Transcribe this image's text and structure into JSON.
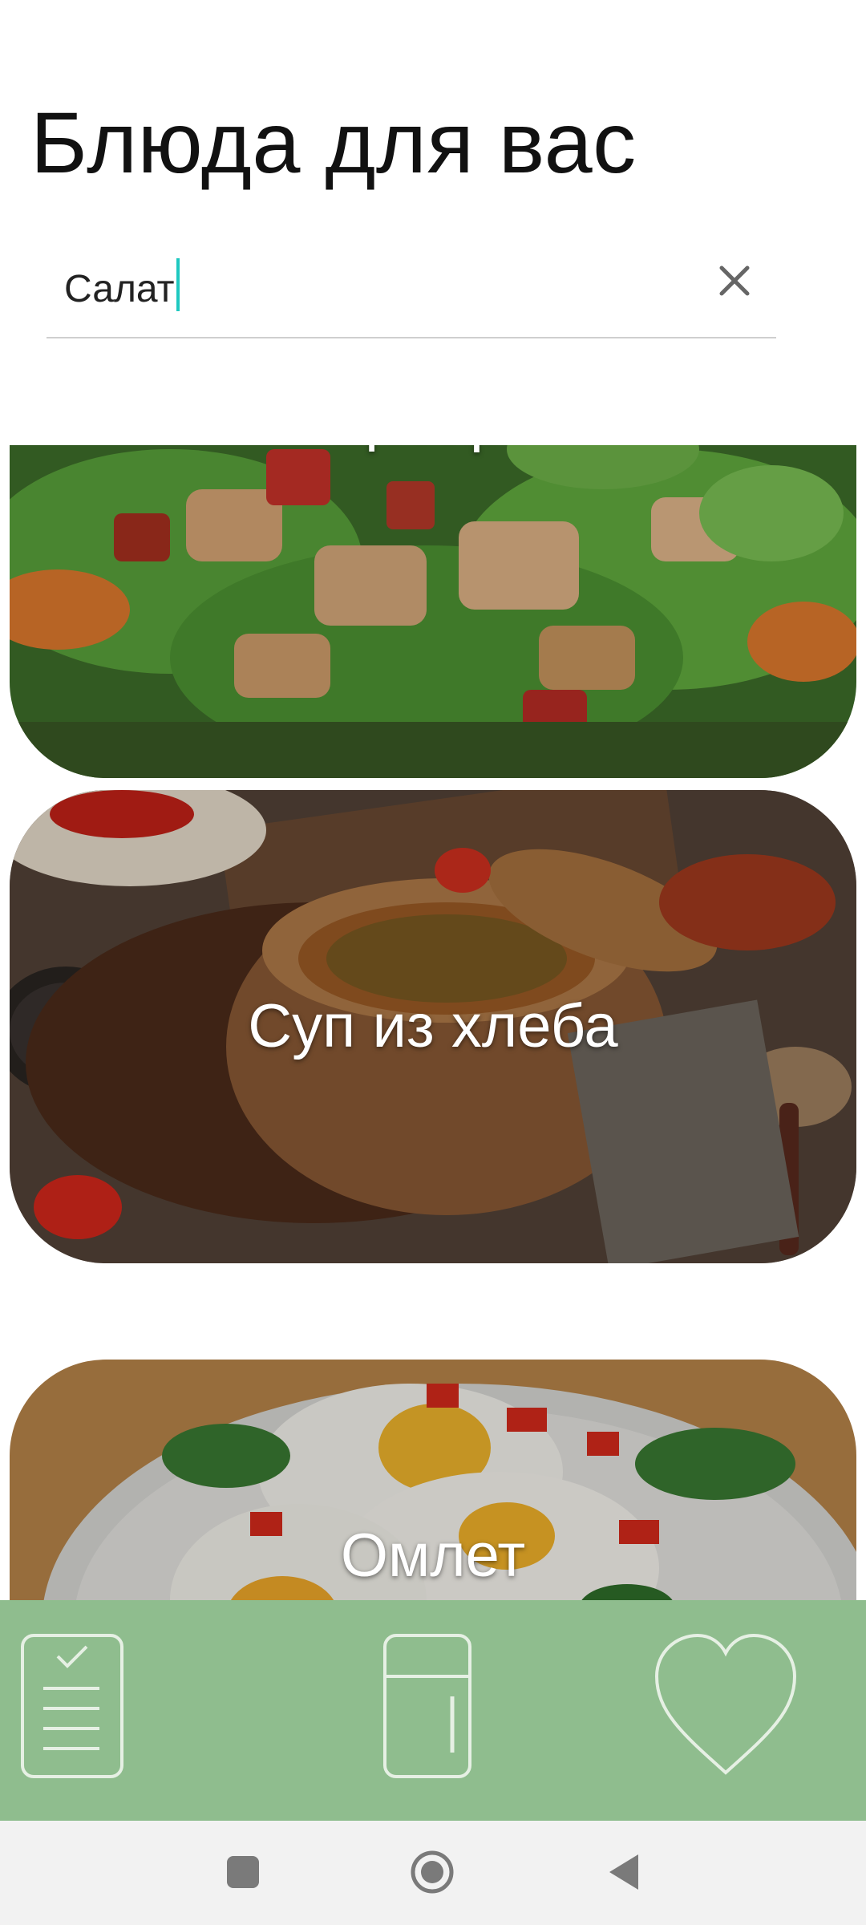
{
  "header": {
    "title": "Блюда для вас"
  },
  "search": {
    "value": "Салат",
    "clear_icon": "close-icon"
  },
  "dishes": [
    {
      "name": "Цезарь",
      "image": "caesar-salad-photo"
    },
    {
      "name": "Суп из хлеба",
      "image": "bread-bowl-soup-photo"
    },
    {
      "name": "Омлет",
      "image": "fried-eggs-photo"
    }
  ],
  "bottom_nav": {
    "background": "#8fbd8e",
    "items": [
      {
        "icon": "checklist-icon"
      },
      {
        "icon": "fridge-icon"
      },
      {
        "icon": "heart-icon"
      }
    ]
  },
  "system_nav": {
    "items": [
      {
        "icon": "recent-apps-icon"
      },
      {
        "icon": "home-icon"
      },
      {
        "icon": "back-icon"
      }
    ]
  }
}
